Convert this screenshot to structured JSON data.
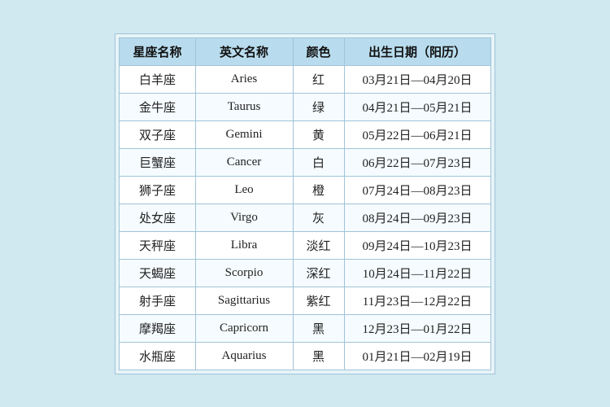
{
  "table": {
    "headers": {
      "zh_name": "星座名称",
      "en_name": "英文名称",
      "color": "颜色",
      "date_range": "出生日期（阳历）"
    },
    "rows": [
      {
        "zh": "白羊座",
        "en": "Aries",
        "color": "红",
        "date": "03月21日—04月20日"
      },
      {
        "zh": "金牛座",
        "en": "Taurus",
        "color": "绿",
        "date": "04月21日—05月21日"
      },
      {
        "zh": "双子座",
        "en": "Gemini",
        "color": "黄",
        "date": "05月22日—06月21日"
      },
      {
        "zh": "巨蟹座",
        "en": "Cancer",
        "color": "白",
        "date": "06月22日—07月23日"
      },
      {
        "zh": "狮子座",
        "en": "Leo",
        "color": "橙",
        "date": "07月24日—08月23日"
      },
      {
        "zh": "处女座",
        "en": "Virgo",
        "color": "灰",
        "date": "08月24日—09月23日"
      },
      {
        "zh": "天秤座",
        "en": "Libra",
        "color": "淡红",
        "date": "09月24日—10月23日"
      },
      {
        "zh": "天蝎座",
        "en": "Scorpio",
        "color": "深红",
        "date": "10月24日—11月22日"
      },
      {
        "zh": "射手座",
        "en": "Sagittarius",
        "color": "紫红",
        "date": "11月23日—12月22日"
      },
      {
        "zh": "摩羯座",
        "en": "Capricorn",
        "color": "黑",
        "date": "12月23日—01月22日"
      },
      {
        "zh": "水瓶座",
        "en": "Aquarius",
        "color": "黑",
        "date": "01月21日—02月19日"
      }
    ]
  }
}
